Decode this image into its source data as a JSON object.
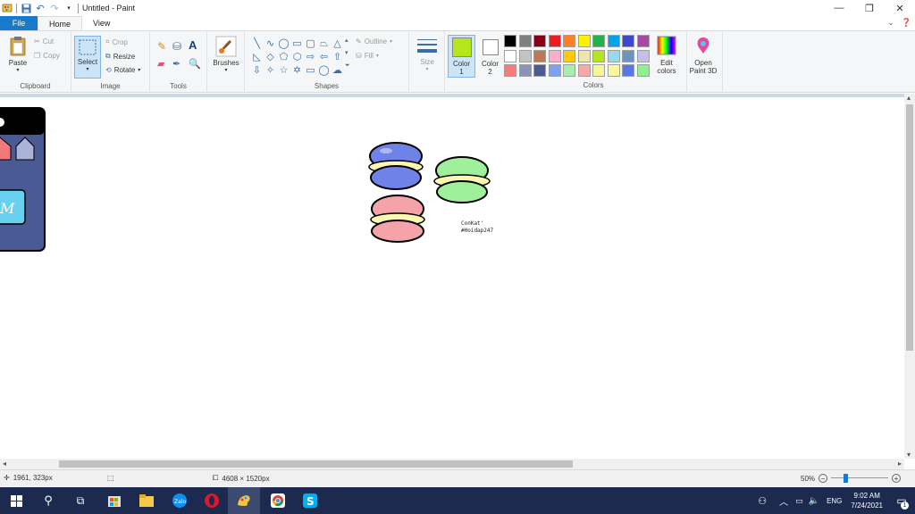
{
  "window": {
    "title": "Untitled - Paint",
    "controls": {
      "minimize": "—",
      "maximize": "❐",
      "close": "✕"
    }
  },
  "tabs": [
    {
      "label": "File"
    },
    {
      "label": "Home"
    },
    {
      "label": "View"
    }
  ],
  "ribbon": {
    "clipboard": {
      "paste": "Paste",
      "cut": "Cut",
      "copy": "Copy",
      "label": "Clipboard"
    },
    "image": {
      "select": "Select",
      "crop": "Crop",
      "resize": "Resize",
      "rotate": "Rotate",
      "label": "Image"
    },
    "tools": {
      "label": "Tools"
    },
    "brushes": {
      "label": "Brushes"
    },
    "shapes": {
      "outline": "Outline",
      "fill": "Fill",
      "label": "Shapes"
    },
    "size": {
      "label": "Size"
    },
    "color1": {
      "label1": "Color",
      "label2": "1",
      "value": "#b5e61d"
    },
    "color2": {
      "label1": "Color",
      "label2": "2",
      "value": "#ffffff"
    },
    "colors_label": "Colors",
    "edit_colors": {
      "line1": "Edit",
      "line2": "colors"
    },
    "paint3d": {
      "line1": "Open",
      "line2": "Paint 3D"
    },
    "palette": [
      "#000000",
      "#7f7f7f",
      "#880015",
      "#ed1c24",
      "#ff7f27",
      "#fff200",
      "#22b14c",
      "#00a2e8",
      "#3f48cc",
      "#a349a4",
      "#ffffff",
      "#c3c3c3",
      "#b97a57",
      "#ffaec9",
      "#ffc90e",
      "#efe4b0",
      "#b5e61d",
      "#99d9ea",
      "#7092be",
      "#c8bfe7",
      "#f87a7a",
      "#8a93b8",
      "#4b5a93",
      "#7ea0f0",
      "#a8ecb0",
      "#f8a8a8",
      "#f5f59a",
      "#f7f7a0",
      "#5a77e8",
      "#8ef08e"
    ]
  },
  "canvas": {
    "credit_line1": "ConKat'",
    "credit_line2": "#Hoidap247",
    "macaron_colors": {
      "blue": "#6f82e8",
      "green": "#9ef09a",
      "pink": "#f5a3a8",
      "cream": "#fbf6b0"
    }
  },
  "status": {
    "cursor": "1961, 323px",
    "dimensions": "4608 × 1520px",
    "zoom": "50%"
  },
  "taskbar": {
    "lang": "ENG",
    "time": "9:02 AM",
    "date": "7/24/2021",
    "notification_count": "1"
  }
}
